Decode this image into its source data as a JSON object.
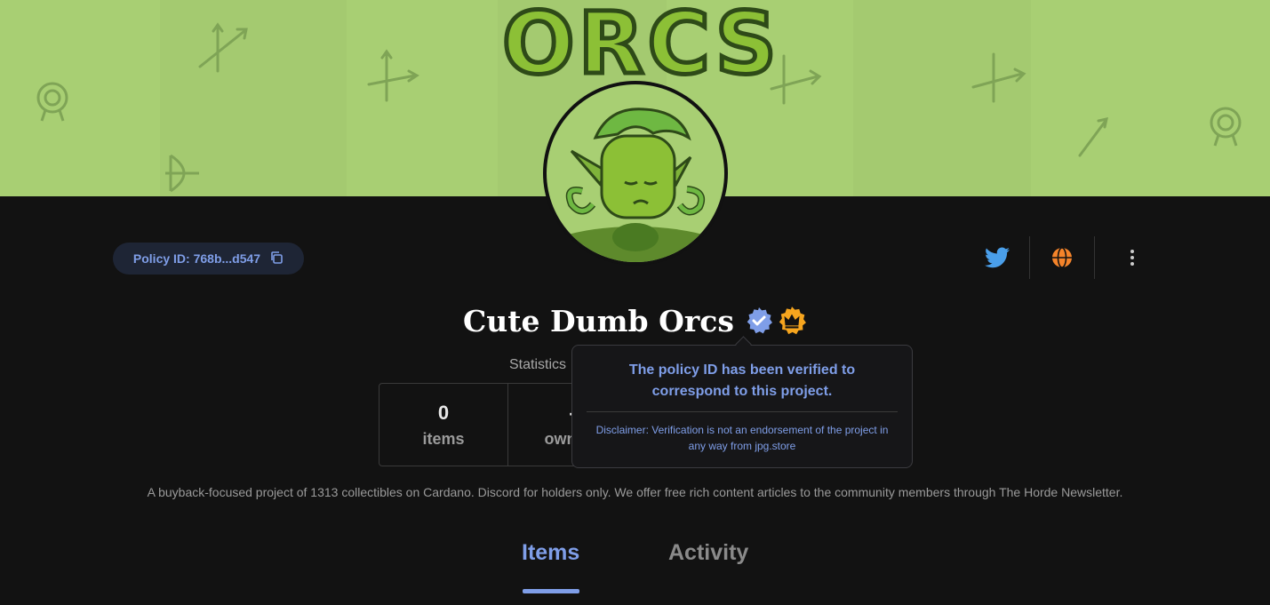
{
  "banner": {
    "title": "ORCS",
    "background": "#a8cf73"
  },
  "avatar": {
    "alt": "orc-avatar"
  },
  "policy": {
    "label": "Policy ID: 768b...d547",
    "icon": "copy-icon"
  },
  "social": [
    {
      "name": "twitter",
      "icon": "twitter-icon",
      "color": "#1d9bf0"
    },
    {
      "name": "website",
      "icon": "globe-icon",
      "color": "#f5842a"
    },
    {
      "name": "more",
      "icon": "more-vertical-icon",
      "color": "#cccccc"
    }
  ],
  "project": {
    "title": "Cute Dumb Orcs",
    "badges": [
      "verified-badge-icon",
      "crown-badge-icon"
    ]
  },
  "stats": {
    "label": "Statistics",
    "items": [
      {
        "value": "0",
        "label": "items"
      },
      {
        "value": "-",
        "label": "owners"
      }
    ]
  },
  "tooltip": {
    "main": "The policy ID has been verified to correspond to this project.",
    "disclaimer": "Disclaimer: Verification is not an endorsement of the project in any way from jpg.store"
  },
  "description": "A buyback-focused project of 1313 collectibles on Cardano. Discord for holders only. We offer free rich content articles to the community members through The Horde Newsletter.",
  "tabs": [
    {
      "label": "Items",
      "active": true
    },
    {
      "label": "Activity",
      "active": false
    }
  ],
  "colors": {
    "accent": "#7f9ee8",
    "background": "#121212"
  }
}
